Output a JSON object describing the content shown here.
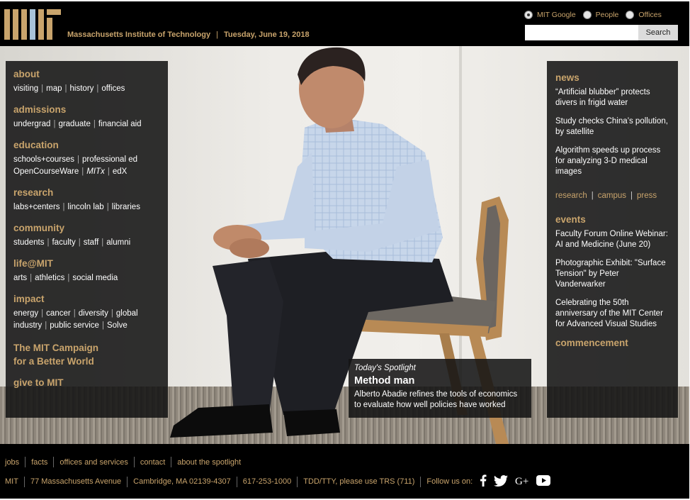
{
  "header": {
    "logo": "MIT",
    "institute": "Massachusetts Institute of Technology",
    "date": "Tuesday, June 19, 2018",
    "search": {
      "options": [
        "MIT Google",
        "People",
        "Offices"
      ],
      "selected": "MIT Google",
      "value": "",
      "button": "Search"
    }
  },
  "left_panel": {
    "sections": [
      {
        "title": "about",
        "links": [
          [
            "visiting",
            "map",
            "history",
            "offices"
          ]
        ]
      },
      {
        "title": "admissions",
        "links": [
          [
            "undergrad",
            "graduate",
            "financial aid"
          ]
        ]
      },
      {
        "title": "education",
        "links": [
          [
            "schools+courses",
            "professional ed"
          ],
          [
            "OpenCourseWare",
            "MITx",
            "edX"
          ]
        ]
      },
      {
        "title": "research",
        "links": [
          [
            "labs+centers",
            "lincoln lab",
            "libraries"
          ]
        ]
      },
      {
        "title": "community",
        "links": [
          [
            "students",
            "faculty",
            "staff",
            "alumni"
          ]
        ]
      },
      {
        "title": "life@MIT",
        "links": [
          [
            "arts",
            "athletics",
            "social media"
          ]
        ]
      },
      {
        "title": "impact",
        "links": [
          [
            "energy",
            "cancer",
            "diversity",
            "global"
          ],
          [
            "industry",
            "public service",
            "Solve"
          ]
        ]
      }
    ],
    "campaign": [
      "The MIT Campaign",
      "for a Better World"
    ],
    "give": "give to MIT"
  },
  "right_panel": {
    "news_title": "news",
    "news": [
      "“Artificial blubber” protects divers in frigid water",
      "Study checks China’s pollution, by satellite",
      "Algorithm speeds up process for analyzing 3-D medical images"
    ],
    "news_links": [
      "research",
      "campus",
      "press"
    ],
    "events_title": "events",
    "events": [
      "Faculty Forum Online Webinar: AI and Medicine (June 20)",
      "Photographic Exhibit: \"Surface Tension\" by Peter Vanderwarker",
      "Celebrating the 50th anniversary of the MIT Center for Advanced Visual Studies"
    ],
    "commencement": "commencement"
  },
  "spotlight": {
    "kicker": "Today's Spotlight",
    "headline": "Method man",
    "description": "Alberto Abadie refines the tools of economics to evaluate how well policies have worked"
  },
  "footer": {
    "row1": [
      "jobs",
      "facts",
      "offices and services",
      "contact",
      "about the spotlight"
    ],
    "row2": [
      "MIT",
      "77 Massachusetts Avenue",
      "Cambridge, MA 02139-4307",
      "617-253-1000",
      "TDD/TTY, please use TRS (711)",
      "Follow us on:"
    ],
    "social_icons": [
      "facebook-icon",
      "twitter-icon",
      "google-plus-icon",
      "youtube-icon"
    ]
  },
  "colors": {
    "accent": "#c9a46c",
    "panel": "#141414",
    "background": "#000000"
  }
}
